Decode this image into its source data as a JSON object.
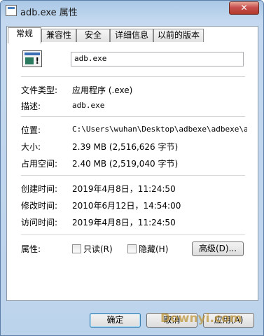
{
  "window": {
    "title": "adb.exe 属性",
    "close_label": "✕"
  },
  "tabs": [
    "常规",
    "兼容性",
    "安全",
    "详细信息",
    "以前的版本"
  ],
  "general": {
    "filename": "adb.exe",
    "type": {
      "label": "文件类型:",
      "value": "应用程序 (.exe)"
    },
    "desc": {
      "label": "描述:",
      "value": "adb.exe"
    },
    "location": {
      "label": "位置:",
      "value": "C:\\Users\\wuhan\\Desktop\\adbexe\\adbexe\\adbexe"
    },
    "size": {
      "label": "大小:",
      "value": "2.39 MB (2,516,626 字节)"
    },
    "size_on_disk": {
      "label": "占用空间:",
      "value": "2.40 MB (2,519,040 字节)"
    },
    "created": {
      "label": "创建时间:",
      "value": "2019年4月8日，11:24:50"
    },
    "modified": {
      "label": "修改时间:",
      "value": "2010年6月12日，14:54:00"
    },
    "accessed": {
      "label": "访问时间:",
      "value": "2019年4月8日，11:24:50"
    },
    "attributes": {
      "label": "属性:",
      "readonly": "只读(R)",
      "hidden": "隐藏(H)",
      "advanced": "高级(D)..."
    }
  },
  "buttons": {
    "ok": "确定",
    "cancel": "取消",
    "apply": "应用(A)"
  },
  "watermark": "Downyi.com"
}
